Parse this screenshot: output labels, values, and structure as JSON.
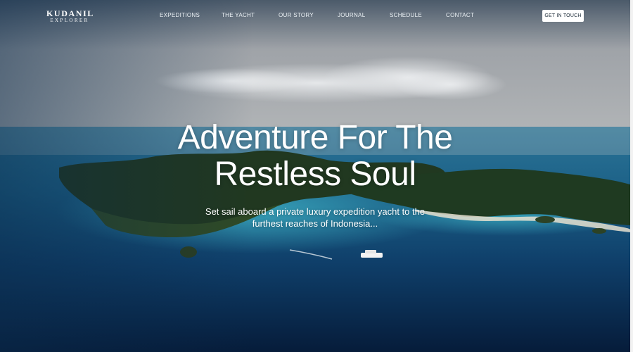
{
  "brand": {
    "name": "KUDANIL",
    "tagline": "EXPLORER"
  },
  "nav": {
    "links": [
      {
        "label": "EXPEDITIONS"
      },
      {
        "label": "THE YACHT"
      },
      {
        "label": "OUR STORY"
      },
      {
        "label": "JOURNAL"
      },
      {
        "label": "SCHEDULE"
      },
      {
        "label": "CONTACT"
      }
    ],
    "cta_label": "GET IN TOUCH"
  },
  "hero": {
    "headline_line1": "Adventure For The",
    "headline_line2": "Restless Soul",
    "subtitle_line1": "Set sail aboard a private luxury expedition yacht to the",
    "subtitle_line2": "furthest reaches of Indonesia..."
  },
  "colors": {
    "sky": "#a7a9ad",
    "ocean_deep": "#071d3a",
    "ocean_mid": "#1a5d86",
    "island": "#223a22",
    "text": "#ffffff",
    "cta_bg": "#ffffff"
  }
}
